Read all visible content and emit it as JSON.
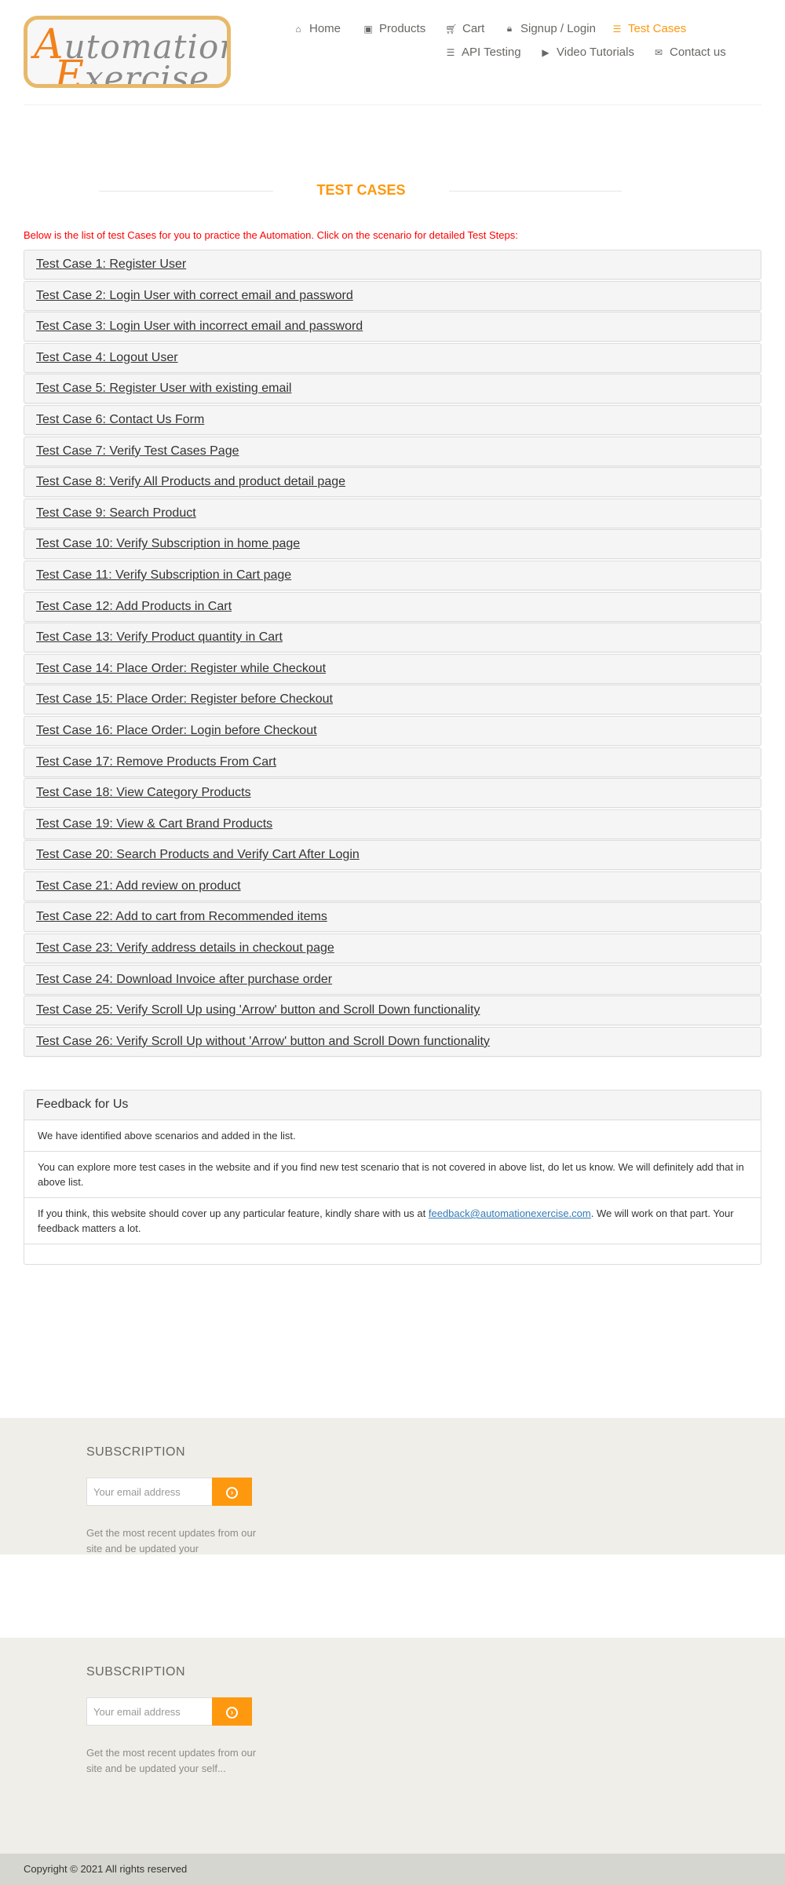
{
  "header": {
    "logo_word1_first": "A",
    "logo_word1_rest": "utomation",
    "logo_word2_first": "E",
    "logo_word2_rest": "xercise",
    "nav": {
      "home": "Home",
      "products": "Products",
      "cart": "Cart",
      "signup_login": "Signup / Login",
      "test_cases": "Test Cases",
      "api_testing": "API Testing",
      "video_tutorials": "Video Tutorials",
      "contact_us": "Contact us"
    },
    "icons": {
      "home": "home-icon",
      "products": "products-icon",
      "cart": "cart-icon",
      "signup_login": "lock-icon",
      "test_cases": "list-icon",
      "api_testing": "list-icon",
      "video_tutorials": "youtube-icon",
      "contact_us": "envelope-icon"
    }
  },
  "main": {
    "title": "TEST CASES",
    "intro": "Below is the list of test Cases for you to practice the Automation. Click on the scenario for detailed Test Steps:",
    "cases": [
      "Test Case 1: Register User",
      "Test Case 2: Login User with correct email and password",
      "Test Case 3: Login User with incorrect email and password",
      "Test Case 4: Logout User",
      "Test Case 5: Register User with existing email",
      "Test Case 6: Contact Us Form",
      "Test Case 7: Verify Test Cases Page",
      "Test Case 8: Verify All Products and product detail page",
      "Test Case 9: Search Product",
      "Test Case 10: Verify Subscription in home page",
      "Test Case 11: Verify Subscription in Cart page",
      "Test Case 12: Add Products in Cart",
      "Test Case 13: Verify Product quantity in Cart",
      "Test Case 14: Place Order: Register while Checkout",
      "Test Case 15: Place Order: Register before Checkout",
      "Test Case 16: Place Order: Login before Checkout",
      "Test Case 17: Remove Products From Cart",
      "Test Case 18: View Category Products",
      "Test Case 19: View & Cart Brand Products",
      "Test Case 20: Search Products and Verify Cart After Login",
      "Test Case 21: Add review on product",
      "Test Case 22: Add to cart from Recommended items",
      "Test Case 23: Verify address details in checkout page",
      "Test Case 24: Download Invoice after purchase order",
      "Test Case 25: Verify Scroll Up using 'Arrow' button and Scroll Down functionality",
      "Test Case 26: Verify Scroll Up without 'Arrow' button and Scroll Down functionality"
    ]
  },
  "feedback": {
    "heading": "Feedback for Us",
    "item1": "We have identified above scenarios and added in the list.",
    "item2": "You can explore more test cases in the website and if you find new test scenario that is not covered in above list, do let us know. We will definitely add that in above list.",
    "item3_before": "If you think, this website should cover up any particular feature, kindly share with us at ",
    "item3_link": "feedback@automationexercise.com",
    "item3_after": ". We will work on that part. Your feedback matters a lot."
  },
  "subscription": {
    "title": "SUBSCRIPTION",
    "placeholder": "Your email address",
    "button_icon": "arrow-circle-right-icon",
    "text_truncated": "Get the most recent updates from our site and be updated your",
    "text_full": "Get the most recent updates from our site and be updated your self..."
  },
  "footer": {
    "copyright": "Copyright © 2021 All rights reserved"
  },
  "colors": {
    "accent": "#fe980f",
    "intro_red": "#ff0000",
    "subscription_bg": "#efeee8",
    "footer_bg": "#d6d6d0",
    "link_blue": "#337ab7"
  }
}
